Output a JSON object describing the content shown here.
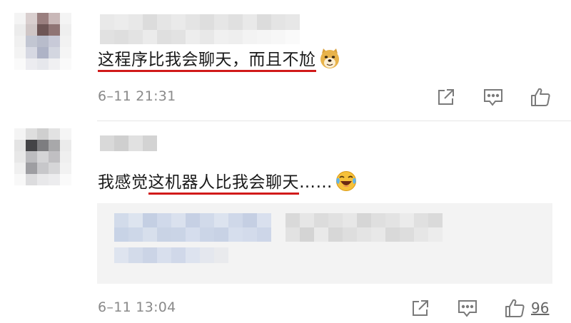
{
  "comments": [
    {
      "text_plain": "",
      "text_highlight": "这程序比我会聊天，而且不尬",
      "text_after": "",
      "emoji": "doge-emoji",
      "time": "6–11 21:31",
      "like_count": ""
    },
    {
      "text_plain": "我感觉",
      "text_highlight": "这机器人比我会聊天",
      "text_after": "……",
      "emoji": "laughing-tears-emoji",
      "time": "6–11 13:04",
      "like_count": "96"
    }
  ],
  "colors": {
    "underline": "#d11a1a",
    "meta_text": "#8a8a8a",
    "icon": "#7a7a7a",
    "quote_bg": "#f3f3f3"
  },
  "icons": [
    "share-icon",
    "comment-icon",
    "like-icon"
  ]
}
